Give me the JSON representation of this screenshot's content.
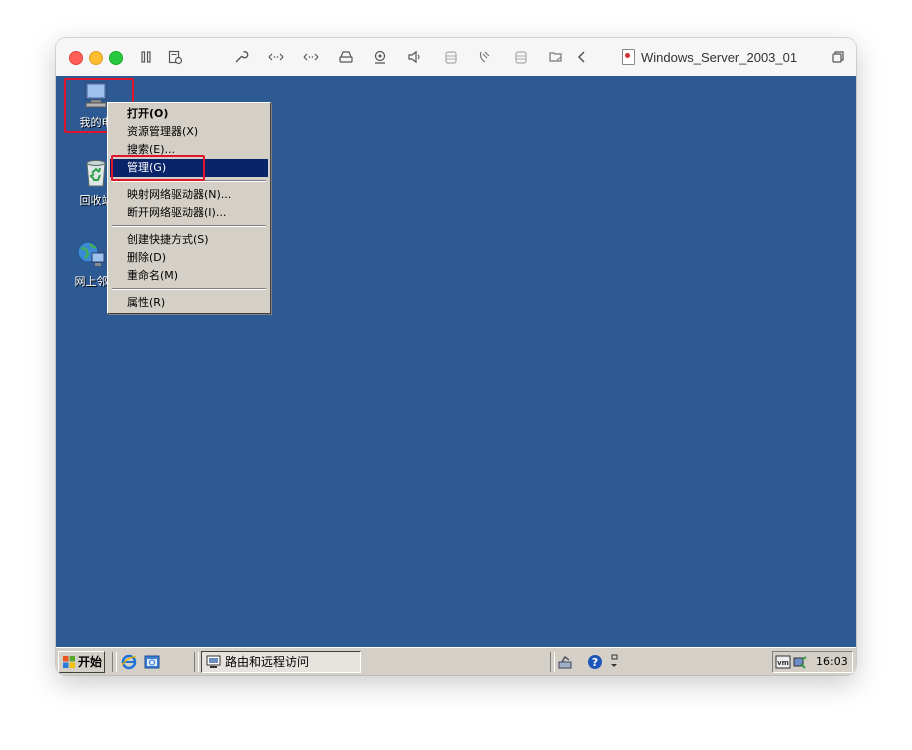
{
  "window": {
    "title": "Windows_Server_2003_01",
    "toolbar_icons": [
      "pause-icon",
      "snapshot-icon",
      "wrench-icon",
      "network-arrows-icon",
      "network-arrows-icon",
      "drive-icon",
      "camera-icon",
      "sound-icon",
      "printer-icon",
      "usb-icon",
      "disk-icon",
      "folder-share-icon",
      "back-chevron-icon",
      "window-restore-icon"
    ]
  },
  "desktop": {
    "icons": [
      {
        "label": "我的电",
        "icon": "my-computer-icon"
      },
      {
        "label": "回收站",
        "icon": "recycle-bin-icon"
      },
      {
        "label": "网上邻",
        "icon": "network-places-icon"
      }
    ]
  },
  "context_menu": {
    "items": [
      {
        "label": "打开(O)",
        "bold": true
      },
      {
        "label": "资源管理器(X)"
      },
      {
        "label": "搜索(E)..."
      },
      {
        "label": "管理(G)",
        "selected": true
      },
      {
        "label": "映射网络驱动器(N)..."
      },
      {
        "label": "断开网络驱动器(I)..."
      },
      {
        "label": "创建快捷方式(S)"
      },
      {
        "label": "删除(D)"
      },
      {
        "label": "重命名(M)"
      },
      {
        "label": "属性(R)"
      }
    ]
  },
  "taskbar": {
    "start_label": "开始",
    "task_label": "路由和远程访问",
    "clock": "16:03",
    "tray_icons": [
      "vmware-icon",
      "network-tray-icon"
    ]
  },
  "colors": {
    "desktop": "#2e5a93",
    "menu_selected": "#0a246a",
    "highlight_box": "#e0142a"
  }
}
